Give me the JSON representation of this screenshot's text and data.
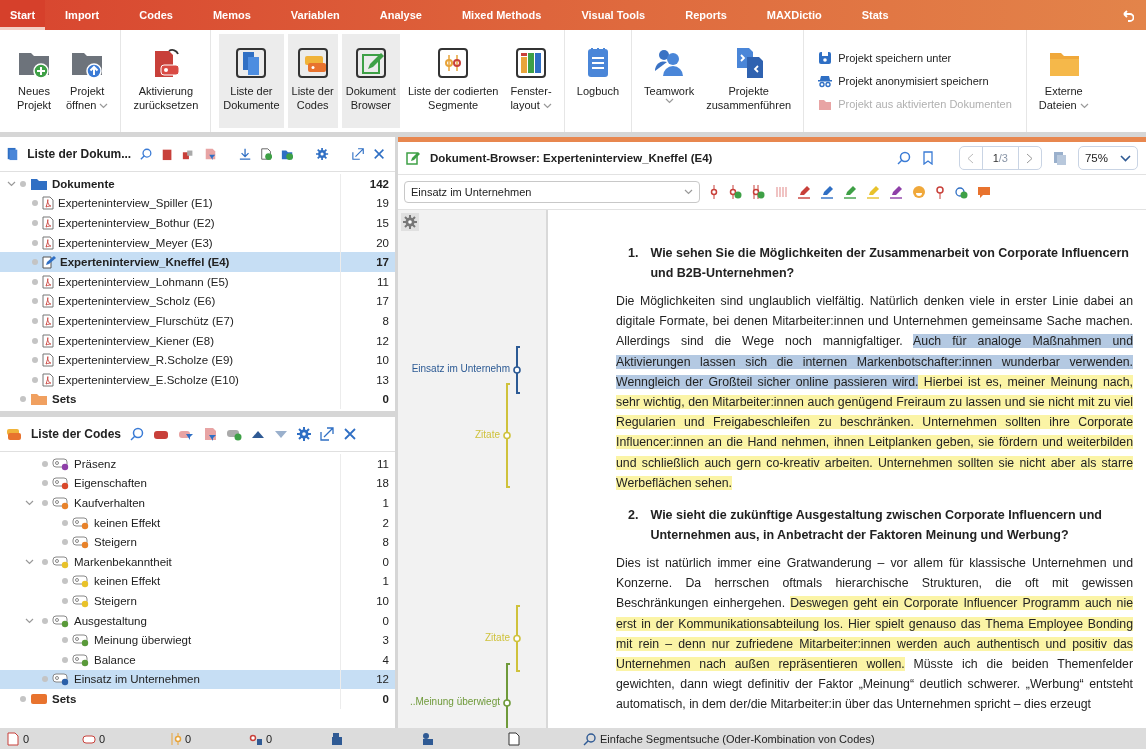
{
  "tabs": [
    {
      "label": "Start",
      "selected": true
    },
    {
      "label": "Import",
      "selected": false
    },
    {
      "label": "Codes",
      "selected": false
    },
    {
      "label": "Memos",
      "selected": false
    },
    {
      "label": "Variablen",
      "selected": false
    },
    {
      "label": "Analyse",
      "selected": false
    },
    {
      "label": "Mixed Methods",
      "selected": false
    },
    {
      "label": "Visual Tools",
      "selected": false
    },
    {
      "label": "Reports",
      "selected": false
    },
    {
      "label": "MAXDictio",
      "selected": false
    },
    {
      "label": "Stats",
      "selected": false
    }
  ],
  "ribbon": [
    {
      "kind": "buttons",
      "buttons": [
        {
          "lines": [
            "Neues",
            "Projekt"
          ],
          "has_menu": false,
          "selected": false
        },
        {
          "lines": [
            "Projekt",
            "öffnen"
          ],
          "has_menu": true,
          "selected": false
        }
      ]
    },
    {
      "kind": "buttons",
      "buttons": [
        {
          "lines": [
            "Aktivierung",
            "zurücksetzen"
          ],
          "has_menu": false,
          "selected": false
        }
      ]
    },
    {
      "kind": "buttons",
      "buttons": [
        {
          "lines": [
            "Liste der",
            "Dokumente"
          ],
          "has_menu": false,
          "selected": true
        },
        {
          "lines": [
            "Liste der",
            "Codes"
          ],
          "has_menu": false,
          "selected": true
        },
        {
          "lines": [
            "Dokument",
            "Browser"
          ],
          "has_menu": false,
          "selected": true
        },
        {
          "lines": [
            "Liste der codierten",
            "Segmente"
          ],
          "has_menu": false,
          "selected": false
        },
        {
          "lines": [
            "Fenster-",
            "layout"
          ],
          "has_menu": true,
          "selected": false
        }
      ]
    },
    {
      "kind": "buttons",
      "buttons": [
        {
          "lines": [
            "Logbuch"
          ],
          "has_menu": false,
          "selected": false
        }
      ]
    },
    {
      "kind": "buttons",
      "buttons": [
        {
          "lines": [
            "Teamwork"
          ],
          "has_menu": true,
          "selected": false
        },
        {
          "lines": [
            "Projekte",
            "zusammenführen"
          ],
          "has_menu": false,
          "selected": false
        }
      ]
    },
    {
      "kind": "actions",
      "actions": [
        {
          "label": "Projekt speichern unter",
          "disabled": false
        },
        {
          "label": "Projekt anonymisiert speichern",
          "disabled": false
        },
        {
          "label": "Projekt aus aktivierten Dokumenten",
          "disabled": true
        }
      ]
    },
    {
      "kind": "buttons",
      "buttons": [
        {
          "lines": [
            "Externe",
            "Dateien"
          ],
          "has_menu": true,
          "selected": false
        }
      ]
    }
  ],
  "document_list": {
    "title": "Liste der Dokum...",
    "root": {
      "label": "Dokumente",
      "count": "142",
      "expanded": true,
      "children": [
        {
          "label": "Experteninterview_Spiller (E1)",
          "count": "19",
          "kind": "pdf",
          "selected": false
        },
        {
          "label": "Experteninterview_Bothur (E2)",
          "count": "15",
          "kind": "pdf",
          "selected": false
        },
        {
          "label": "Experteninterview_Meyer (E3)",
          "count": "20",
          "kind": "pdf",
          "selected": false
        },
        {
          "label": "Experteninterview_Kneffel (E4)",
          "count": "17",
          "kind": "text",
          "selected": true
        },
        {
          "label": "Experteninterview_Lohmann (E5)",
          "count": "11",
          "kind": "pdf",
          "selected": false
        },
        {
          "label": "Experteninterview_Scholz (E6)",
          "count": "17",
          "kind": "pdf",
          "selected": false
        },
        {
          "label": "Experteninterview_Flurschütz (E7)",
          "count": "8",
          "kind": "pdf",
          "selected": false
        },
        {
          "label": "Experteninterview_Kiener (E8)",
          "count": "12",
          "kind": "pdf",
          "selected": false
        },
        {
          "label": "Experteninterview_R.Scholze (E9)",
          "count": "10",
          "kind": "pdf",
          "selected": false
        },
        {
          "label": "Experteninterview_E.Scholze (E10)",
          "count": "13",
          "kind": "pdf",
          "selected": false
        }
      ]
    },
    "sets": {
      "label": "Sets",
      "count": "0"
    }
  },
  "code_list": {
    "title": "Liste der Codes",
    "codes": [
      {
        "label": "Präsenz",
        "count": "11",
        "color": "#8e3fa8",
        "selected": false
      },
      {
        "label": "Eigenschaften",
        "count": "18",
        "color": "#d9482b",
        "selected": false
      },
      {
        "label": "Kaufverhalten",
        "count": "1",
        "color": "#e8822a",
        "selected": false,
        "expanded": true,
        "children": [
          {
            "label": "keinen Effekt",
            "count": "2",
            "color": "#e8822a",
            "selected": false
          },
          {
            "label": "Steigern",
            "count": "8",
            "color": "#e8822a",
            "selected": false
          }
        ]
      },
      {
        "label": "Markenbekanntheit",
        "count": "0",
        "color": "#e8c22a",
        "selected": false,
        "expanded": true,
        "children": [
          {
            "label": "keinen Effekt",
            "count": "1",
            "color": "#e8c22a",
            "selected": false
          },
          {
            "label": "Steigern",
            "count": "10",
            "color": "#e8c22a",
            "selected": false
          }
        ]
      },
      {
        "label": "Ausgestaltung",
        "count": "0",
        "color": "#5a9a3a",
        "selected": false,
        "expanded": true,
        "children": [
          {
            "label": "Meinung überwiegt",
            "count": "3",
            "color": "#5a9a3a",
            "selected": false
          },
          {
            "label": "Balance",
            "count": "4",
            "color": "#5a9a3a",
            "selected": false
          }
        ]
      },
      {
        "label": "Einsatz im Unternehmen",
        "count": "12",
        "color": "#2a5fa8",
        "selected": true
      }
    ],
    "sets": {
      "label": "Sets",
      "count": "0"
    }
  },
  "document_browser": {
    "title": "Dokument-Browser: Experteninterview_Kneffel (E4)",
    "page": "**1**/3",
    "zoom": "75%",
    "code_select": "Einsatz im Unternehmen",
    "margin_codes": [
      {
        "label": "Einsatz im Unternehm",
        "color": "#2c5a94"
      },
      {
        "label": "Zitate",
        "color": "#cfc23c"
      },
      {
        "label": "Zitate",
        "color": "#cfc23c"
      },
      {
        "label": "..Meinung überwiegt",
        "color": "#6f9a3a"
      }
    ],
    "blocks": [
      {
        "kind": "question",
        "number": "1.",
        "text": "Wie sehen Sie die Möglichkeiten der Zusammenarbeit von Corporate Influencern und B2B-Unternehmen?"
      },
      {
        "kind": "paragraph",
        "segments": [
          {
            "text": "Die Möglichkeiten sind unglaublich vielfältig. Natürlich denken viele in erster Linie dabei an digitale Formate, bei denen Mitarbeiter:innen und Unternehmen gemeinsame Sache machen. Allerdings sind die Wege noch mannigfaltiger. "
          },
          {
            "text": "Auch für analoge Maßnahmen und Aktivierungen lassen sich die internen Markenbotschafter:innen wunderbar verwenden. Wenngleich der Großteil sicher online passieren wird.",
            "color": "#b4c9e2"
          },
          {
            "text": " Hierbei ist es, meiner Meinung nach, sehr wichtig, den Mitarbeiter:innen auch genügend Freiraum zu lassen und sie nicht mit zu viel Regularien und Freigabeschleifen zu beschränken. Unternehmen sollten ihre Corporate Influencer:innen an die Hand nehmen, ihnen Leitplanken geben, sie fördern und weiterbilden und schließlich auch gern co-kreativ arbeiten. Unternehmen sollten sie nicht aber als starre Werbeflächen sehen.",
            "color": "#fbf4a6"
          }
        ]
      },
      {
        "kind": "question",
        "number": "2.",
        "text": "Wie sieht die zukünftige Ausgestaltung zwischen Corporate Influencern und Unternehmen aus, in Anbetracht der Faktoren Meinung und Werbung?"
      },
      {
        "kind": "paragraph",
        "segments": [
          {
            "text": "Dies ist natürlich immer eine Gratwanderung – vor allem für klassische Unternehmen und Konzerne. Da herrschen oftmals hierarchische Strukturen, die oft mit gewissen Beschränkungen einhergehen. "
          },
          {
            "text": "Deswegen geht ein Corporate Influencer Programm auch nie erst in der Kommunikationsabteilung los. Hier spielt genauso das Thema Employee Bonding mit rein – denn nur zufriedene Mitarbeiter:innen werden auch authentisch und positiv das Unternehmen nach außen repräsentieren wollen.",
            "color": "#fbf4a6"
          },
          {
            "text": " Müsste ich die beiden Themenfelder gewichten, dann wiegt definitiv der Faktor „Meinung“ deutlich schwerer. „Werbung“ entsteht automatisch, in dem der/die Mitarbeiter:in über das Unternehmen spricht – dies erzeugt"
          }
        ]
      }
    ]
  },
  "status_bar": {
    "counters": [
      "0",
      "0",
      "0",
      "0"
    ],
    "search_mode": "Einfache Segmentsuche (Oder-Kombination von Codes)"
  }
}
